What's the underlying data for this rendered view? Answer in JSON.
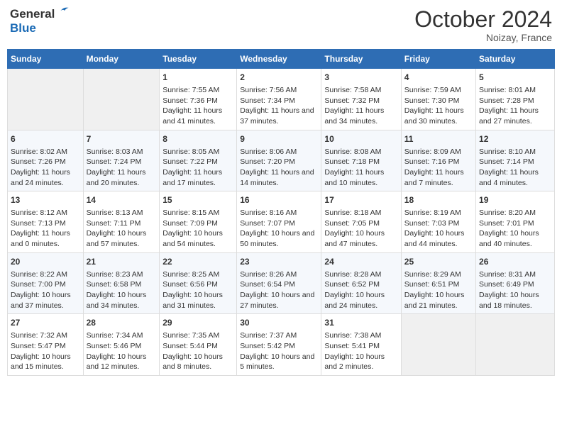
{
  "header": {
    "logo_line1": "General",
    "logo_line2": "Blue",
    "month_title": "October 2024",
    "location": "Noizay, France"
  },
  "days_of_week": [
    "Sunday",
    "Monday",
    "Tuesday",
    "Wednesday",
    "Thursday",
    "Friday",
    "Saturday"
  ],
  "weeks": [
    [
      {
        "day": "",
        "info": ""
      },
      {
        "day": "",
        "info": ""
      },
      {
        "day": "1",
        "info": "Sunrise: 7:55 AM\nSunset: 7:36 PM\nDaylight: 11 hours and 41 minutes."
      },
      {
        "day": "2",
        "info": "Sunrise: 7:56 AM\nSunset: 7:34 PM\nDaylight: 11 hours and 37 minutes."
      },
      {
        "day": "3",
        "info": "Sunrise: 7:58 AM\nSunset: 7:32 PM\nDaylight: 11 hours and 34 minutes."
      },
      {
        "day": "4",
        "info": "Sunrise: 7:59 AM\nSunset: 7:30 PM\nDaylight: 11 hours and 30 minutes."
      },
      {
        "day": "5",
        "info": "Sunrise: 8:01 AM\nSunset: 7:28 PM\nDaylight: 11 hours and 27 minutes."
      }
    ],
    [
      {
        "day": "6",
        "info": "Sunrise: 8:02 AM\nSunset: 7:26 PM\nDaylight: 11 hours and 24 minutes."
      },
      {
        "day": "7",
        "info": "Sunrise: 8:03 AM\nSunset: 7:24 PM\nDaylight: 11 hours and 20 minutes."
      },
      {
        "day": "8",
        "info": "Sunrise: 8:05 AM\nSunset: 7:22 PM\nDaylight: 11 hours and 17 minutes."
      },
      {
        "day": "9",
        "info": "Sunrise: 8:06 AM\nSunset: 7:20 PM\nDaylight: 11 hours and 14 minutes."
      },
      {
        "day": "10",
        "info": "Sunrise: 8:08 AM\nSunset: 7:18 PM\nDaylight: 11 hours and 10 minutes."
      },
      {
        "day": "11",
        "info": "Sunrise: 8:09 AM\nSunset: 7:16 PM\nDaylight: 11 hours and 7 minutes."
      },
      {
        "day": "12",
        "info": "Sunrise: 8:10 AM\nSunset: 7:14 PM\nDaylight: 11 hours and 4 minutes."
      }
    ],
    [
      {
        "day": "13",
        "info": "Sunrise: 8:12 AM\nSunset: 7:13 PM\nDaylight: 11 hours and 0 minutes."
      },
      {
        "day": "14",
        "info": "Sunrise: 8:13 AM\nSunset: 7:11 PM\nDaylight: 10 hours and 57 minutes."
      },
      {
        "day": "15",
        "info": "Sunrise: 8:15 AM\nSunset: 7:09 PM\nDaylight: 10 hours and 54 minutes."
      },
      {
        "day": "16",
        "info": "Sunrise: 8:16 AM\nSunset: 7:07 PM\nDaylight: 10 hours and 50 minutes."
      },
      {
        "day": "17",
        "info": "Sunrise: 8:18 AM\nSunset: 7:05 PM\nDaylight: 10 hours and 47 minutes."
      },
      {
        "day": "18",
        "info": "Sunrise: 8:19 AM\nSunset: 7:03 PM\nDaylight: 10 hours and 44 minutes."
      },
      {
        "day": "19",
        "info": "Sunrise: 8:20 AM\nSunset: 7:01 PM\nDaylight: 10 hours and 40 minutes."
      }
    ],
    [
      {
        "day": "20",
        "info": "Sunrise: 8:22 AM\nSunset: 7:00 PM\nDaylight: 10 hours and 37 minutes."
      },
      {
        "day": "21",
        "info": "Sunrise: 8:23 AM\nSunset: 6:58 PM\nDaylight: 10 hours and 34 minutes."
      },
      {
        "day": "22",
        "info": "Sunrise: 8:25 AM\nSunset: 6:56 PM\nDaylight: 10 hours and 31 minutes."
      },
      {
        "day": "23",
        "info": "Sunrise: 8:26 AM\nSunset: 6:54 PM\nDaylight: 10 hours and 27 minutes."
      },
      {
        "day": "24",
        "info": "Sunrise: 8:28 AM\nSunset: 6:52 PM\nDaylight: 10 hours and 24 minutes."
      },
      {
        "day": "25",
        "info": "Sunrise: 8:29 AM\nSunset: 6:51 PM\nDaylight: 10 hours and 21 minutes."
      },
      {
        "day": "26",
        "info": "Sunrise: 8:31 AM\nSunset: 6:49 PM\nDaylight: 10 hours and 18 minutes."
      }
    ],
    [
      {
        "day": "27",
        "info": "Sunrise: 7:32 AM\nSunset: 5:47 PM\nDaylight: 10 hours and 15 minutes."
      },
      {
        "day": "28",
        "info": "Sunrise: 7:34 AM\nSunset: 5:46 PM\nDaylight: 10 hours and 12 minutes."
      },
      {
        "day": "29",
        "info": "Sunrise: 7:35 AM\nSunset: 5:44 PM\nDaylight: 10 hours and 8 minutes."
      },
      {
        "day": "30",
        "info": "Sunrise: 7:37 AM\nSunset: 5:42 PM\nDaylight: 10 hours and 5 minutes."
      },
      {
        "day": "31",
        "info": "Sunrise: 7:38 AM\nSunset: 5:41 PM\nDaylight: 10 hours and 2 minutes."
      },
      {
        "day": "",
        "info": ""
      },
      {
        "day": "",
        "info": ""
      }
    ]
  ]
}
